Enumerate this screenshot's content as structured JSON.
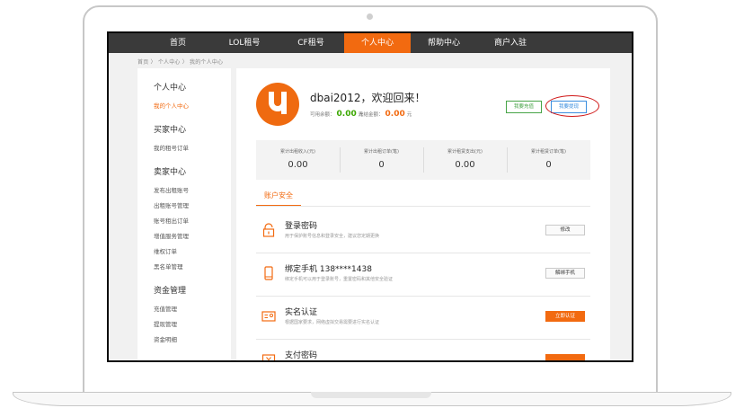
{
  "nav": {
    "items": [
      "首页",
      "LOL租号",
      "CF租号",
      "个人中心",
      "帮助中心",
      "商户入驻"
    ],
    "active_index": 3
  },
  "breadcrumb": "首页 〉 个人中心 〉 我的个人中心",
  "sidebar": {
    "sections": [
      {
        "title": "个人中心",
        "links": [
          "我的个人中心"
        ]
      },
      {
        "title": "买家中心",
        "links": [
          "我的租号订单"
        ]
      },
      {
        "title": "卖家中心",
        "links": [
          "发布出租账号",
          "出租账号管理",
          "账号租出订单",
          "增值服务管理",
          "维权订单",
          "黑名单管理"
        ]
      },
      {
        "title": "资金管理",
        "links": [
          "充值管理",
          "提现管理",
          "资金明细"
        ]
      }
    ],
    "active_link": "我的个人中心"
  },
  "profile": {
    "welcome": "dbai2012，欢迎回来！",
    "available_label": "可用余额：",
    "available_value": "0.00",
    "available_unit": "元",
    "frozen_label": "冻结金额：",
    "frozen_value": "0.00",
    "frozen_unit": "元",
    "recharge_button": "我要充值",
    "withdraw_button": "我要提现"
  },
  "stats": [
    {
      "label": "累计出租收入(元)",
      "value": "0.00"
    },
    {
      "label": "累计出租订单(笔)",
      "value": "0"
    },
    {
      "label": "累计租赁支出(元)",
      "value": "0.00"
    },
    {
      "label": "累计租赁订单(笔)",
      "value": "0"
    }
  ],
  "security": {
    "tab": "账户安全",
    "items": [
      {
        "title": "登录密码",
        "desc": "用于保护账号信息和登录安全，建议您定期更换",
        "button": "修改",
        "icon": "lock-icon"
      },
      {
        "title": "绑定手机 138****1438",
        "desc": "绑定手机可以用于登录账号，重置密码和其他安全验证",
        "button": "解绑手机",
        "icon": "phone-icon"
      },
      {
        "title": "实名认证",
        "desc": "根据国家要求，网络虚拟交易需要进行实名认证",
        "button": "立即认证",
        "icon": "id-card-icon"
      },
      {
        "title": "支付密码",
        "desc": "",
        "button": "",
        "icon": "payment-icon"
      }
    ]
  },
  "colors": {
    "accent": "#f26a10",
    "nav_bg": "#3a3a3a",
    "success": "#3ba700",
    "highlight_circle": "#d01818"
  }
}
